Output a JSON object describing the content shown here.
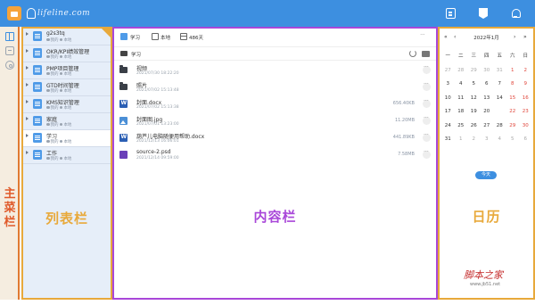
{
  "app": {
    "brand": "lifeline.com",
    "colors": {
      "accent": "#3d8fe0",
      "main_sidebar_border": "#e07a32",
      "list_border": "#e8a93b",
      "content_border": "#a947d9",
      "weekend": "#e0453a"
    }
  },
  "annotations": {
    "main_bar": "主\n菜\n栏",
    "list_bar": "列表栏",
    "content_bar": "内容栏",
    "calendar": "日历"
  },
  "list": {
    "items": [
      {
        "title": "g2s3tq",
        "owner": "我的",
        "scope": "本地"
      },
      {
        "title": "OKR/KPI绩效管理",
        "owner": "我的",
        "scope": "本地"
      },
      {
        "title": "PMP项目管理",
        "owner": "我的",
        "scope": "本地"
      },
      {
        "title": "GTD时间管理",
        "owner": "我的",
        "scope": "本地"
      },
      {
        "title": "KMS知识管理",
        "owner": "我的",
        "scope": "本地"
      },
      {
        "title": "家庭",
        "owner": "我的",
        "scope": "本地"
      },
      {
        "title": "学习",
        "owner": "我的",
        "scope": "本地"
      },
      {
        "title": "工作",
        "owner": "我的",
        "scope": "本地"
      }
    ],
    "active_index": 6
  },
  "content": {
    "breadcrumb": {
      "name": "学习",
      "scope": "本地",
      "days": "486天"
    },
    "path": "学习",
    "files": [
      {
        "type": "folder",
        "name": "视频",
        "time": "2021/07/30 18:22:20",
        "size": ""
      },
      {
        "type": "folder",
        "name": "照片",
        "time": "2021/07/02 15:13:48",
        "size": ""
      },
      {
        "type": "word",
        "name": "封面.docx",
        "time": "2021/07/02 15:13:38",
        "size": "656.40KB"
      },
      {
        "type": "image",
        "name": "封面图.jpg",
        "time": "2021/07/01 13:23:00",
        "size": "11.20MB"
      },
      {
        "type": "word",
        "name": "葫芦儿电脑随便用帮助.docx",
        "time": "2021/12/13 16:06:01",
        "size": "441.89KB"
      },
      {
        "type": "psd",
        "name": "source-2.psd",
        "time": "2021/12/14 09:59:00",
        "size": "7.58MB"
      }
    ]
  },
  "calendar": {
    "nav": {
      "prev_year": "«",
      "prev_month": "‹",
      "next_month": "›",
      "next_year": "»"
    },
    "title": "2022年1月",
    "weekdays": [
      "一",
      "二",
      "三",
      "四",
      "五",
      "六",
      "日"
    ],
    "weeks": [
      [
        "27",
        "28",
        "29",
        "30",
        "31",
        "1",
        "2"
      ],
      [
        "3",
        "4",
        "5",
        "6",
        "7",
        "8",
        "9"
      ],
      [
        "10",
        "11",
        "12",
        "13",
        "14",
        "15",
        "16"
      ],
      [
        "17",
        "18",
        "19",
        "20",
        "21",
        "22",
        "23"
      ],
      [
        "24",
        "25",
        "26",
        "27",
        "28",
        "29",
        "30"
      ],
      [
        "31",
        "1",
        "2",
        "3",
        "4",
        "5",
        "6"
      ]
    ],
    "today": "21",
    "today_button": "今天"
  },
  "watermark": {
    "title": "脚本之家",
    "url": "www.jb51.net"
  }
}
